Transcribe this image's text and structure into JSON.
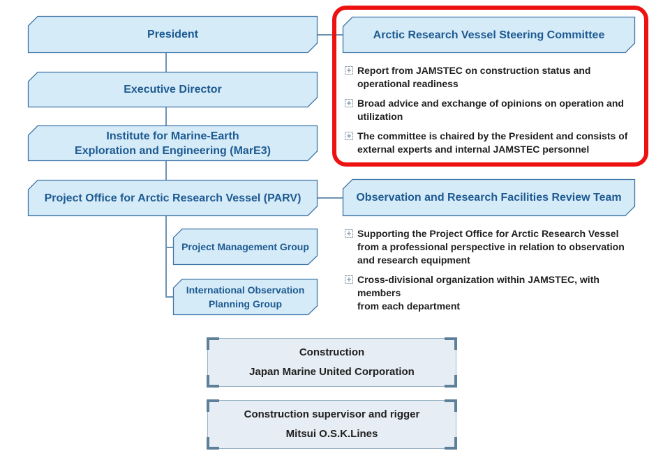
{
  "colors": {
    "node_fill": "#d6ebf8",
    "node_stroke": "#3f74a6",
    "node_text": "#1d5a91",
    "connector": "#6d93b3",
    "highlight": "#ee1111",
    "contract_fill": "#e6edf4",
    "contract_bracket": "#5e7f99"
  },
  "nodes": {
    "president": "President",
    "executive_director": "Executive Director",
    "mare3": [
      "Institute for Marine-Earth",
      "Exploration and Engineering (MarE3)"
    ],
    "parv": "Project Office for Arctic Research Vessel (PARV)",
    "pmg": "Project Management Group",
    "iopg": [
      "International Observation",
      "Planning Group"
    ],
    "steering_committee": "Arctic Research Vessel Steering Committee",
    "review_team": "Observation and Research Facilities Review Team"
  },
  "steering_committee_notes": [
    [
      "Report from JAMSTEC on construction status and",
      "operational readiness"
    ],
    [
      "Broad advice and exchange of opinions on operation and",
      "utilization"
    ],
    [
      "The committee is chaired by the President and consists of",
      "external experts and internal JAMSTEC personnel"
    ]
  ],
  "review_team_notes": [
    [
      "Supporting the Project Office for Arctic Research Vessel",
      "from a professional perspective in relation to observation",
      "and research equipment"
    ],
    [
      "Cross-divisional organization within JAMSTEC, with members",
      "from each department"
    ]
  ],
  "contractors": [
    {
      "role": "Construction",
      "name": "Japan Marine United Corporation"
    },
    {
      "role": "Construction supervisor and rigger",
      "name": "Mitsui O.S.K.Lines"
    }
  ],
  "bullet_icon": "boxed-plus-icon"
}
